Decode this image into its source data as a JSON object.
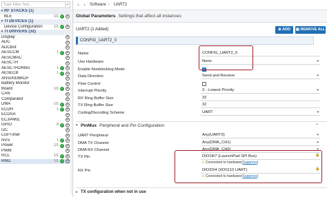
{
  "filter": {
    "placeholder": "Type Filter Text..."
  },
  "tree": [
    {
      "kind": "section",
      "label": "RF STACKS (1)",
      "caret": "▾"
    },
    {
      "kind": "item",
      "label": "BLE",
      "count": "1/1",
      "status": "ok"
    },
    {
      "kind": "section",
      "label": "TI DEVICES (1)",
      "caret": "▾"
    },
    {
      "kind": "item",
      "label": "Device Configuration",
      "count": "1/1",
      "status": "ok"
    },
    {
      "kind": "section",
      "label": "TI DRIVERS (32)",
      "caret": "▾"
    },
    {
      "kind": "sub",
      "label": "Display",
      "count": "",
      "status": "add"
    },
    {
      "kind": "sub",
      "label": "ADC",
      "count": "",
      "status": "add"
    },
    {
      "kind": "sub",
      "label": "ADCBuf",
      "count": "",
      "status": "add"
    },
    {
      "kind": "sub",
      "label": "AESCCM",
      "count": "1",
      "status": "ok"
    },
    {
      "kind": "sub",
      "label": "AESCMAC",
      "count": "",
      "status": "add"
    },
    {
      "kind": "sub",
      "label": "AESCTR",
      "count": "",
      "status": "add"
    },
    {
      "kind": "sub",
      "label": "AESCTRDRBG",
      "count": "1",
      "status": "ok"
    },
    {
      "kind": "sub",
      "label": "AESECB",
      "count": "1",
      "status": "ok"
    },
    {
      "kind": "sub",
      "label": "ANSIX936KDF",
      "count": "",
      "status": "add"
    },
    {
      "kind": "sub",
      "label": "Battery Monitor",
      "count": "",
      "status": "add"
    },
    {
      "kind": "sub",
      "label": "Board",
      "count": "1/1",
      "status": "ok"
    },
    {
      "kind": "sub",
      "label": "CAN",
      "count": "",
      "status": "add"
    },
    {
      "kind": "sub",
      "label": "Comparator",
      "count": "",
      "status": "add"
    },
    {
      "kind": "sub",
      "label": "DMA",
      "count": "1/1",
      "status": "ok"
    },
    {
      "kind": "sub",
      "label": "ECDH",
      "count": "1",
      "status": "ok"
    },
    {
      "kind": "sub",
      "label": "ECDSA",
      "count": "",
      "status": "add"
    },
    {
      "kind": "sub",
      "label": "ECJPAKE",
      "count": "",
      "status": "add"
    },
    {
      "kind": "sub",
      "label": "GPIO",
      "count": "8",
      "status": "ok"
    },
    {
      "kind": "sub",
      "label": "I2C",
      "count": "",
      "status": "add"
    },
    {
      "kind": "sub",
      "label": "LGPTimer",
      "count": "",
      "status": "add"
    },
    {
      "kind": "sub",
      "label": "NVS",
      "count": "1",
      "status": "ok"
    },
    {
      "kind": "sub",
      "label": "Power",
      "count": "1/1",
      "status": "ok"
    },
    {
      "kind": "sub",
      "label": "PWM",
      "count": "",
      "status": "add"
    },
    {
      "kind": "sub",
      "label": "RCL",
      "count": "1/1",
      "status": "ok"
    },
    {
      "kind": "sub",
      "label": "RNG",
      "count": "1/1",
      "status": "ok"
    }
  ],
  "nav": {
    "crumb1": "Software",
    "crumb2": "UART2"
  },
  "global_params": {
    "title": "Global Parameters",
    "subtitle": "Settings that affect all instances"
  },
  "module": {
    "title": "UART2 (1 Added)",
    "add_label": "ADD",
    "remove_label": "REMOVE ALL"
  },
  "instance": {
    "name": "CONFIG_UART2_0"
  },
  "fields": [
    {
      "label": "Name",
      "value": "CONFIG_UART2_0",
      "type": "text"
    },
    {
      "label": "Use Hardware",
      "value": "None",
      "type": "select"
    },
    {
      "label": "Enable Nonblocking Mode",
      "value": "✓",
      "type": "checkbox",
      "checked": true
    },
    {
      "label": "Data Direction",
      "value": "Send and Receive",
      "type": "select"
    },
    {
      "label": "Flow Control",
      "value": "",
      "type": "checkbox",
      "checked": false
    },
    {
      "label": "Interrupt Priority",
      "value": "3 - Lowest Priority",
      "type": "select"
    },
    {
      "label": "RX Ring Buffer Size",
      "value": "32",
      "type": "text"
    },
    {
      "label": "TX Ring Buffer Size",
      "value": "32",
      "type": "text"
    },
    {
      "label": "Coding/Decoding Scheme",
      "value": "UART",
      "type": "select"
    }
  ],
  "pinmux": {
    "title": "PinMux",
    "subtitle": "Peripheral and Pin Configuration"
  },
  "pin_fields": [
    {
      "label": "UART Peripheral",
      "value": "Any(UART0)"
    },
    {
      "label": "DMA TX Channel",
      "value": "Any(DMA_CH1)"
    },
    {
      "label": "DMA RX Channel",
      "value": "Any(DMA_CH0)"
    },
    {
      "label": "TX Pin",
      "value": "DIO18/7 (LaunchPad SPI Bus)"
    },
    {
      "label": "RX Pin",
      "value": "DIO20/4 (XDS110 UART)"
    }
  ],
  "warn": {
    "text": "Connected to hardware(",
    "link": "Suppress",
    "tail": ")"
  },
  "tx_conf": {
    "title": "TX configuration when not in use"
  }
}
